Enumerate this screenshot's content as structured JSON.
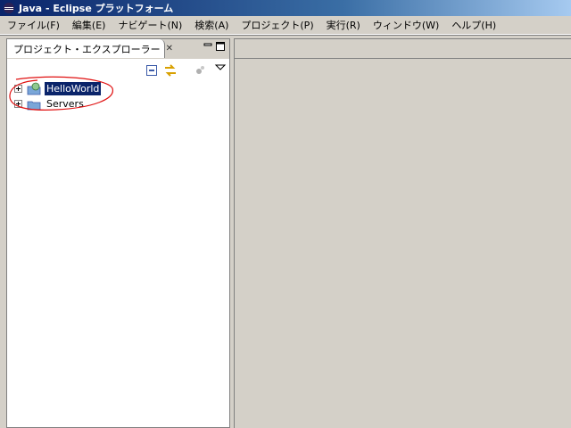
{
  "window": {
    "title": "Java - Eclipse プラットフォーム"
  },
  "menubar": {
    "items": [
      {
        "label": "ファイル(F)"
      },
      {
        "label": "編集(E)"
      },
      {
        "label": "ナビゲート(N)"
      },
      {
        "label": "検索(A)"
      },
      {
        "label": "プロジェクト(P)"
      },
      {
        "label": "実行(R)"
      },
      {
        "label": "ウィンドウ(W)"
      },
      {
        "label": "ヘルプ(H)"
      }
    ]
  },
  "explorer": {
    "tab_label": "プロジェクト・エクスプローラー",
    "close_glyph": "✕",
    "tree": [
      {
        "label": "HelloWorld",
        "selected": true
      },
      {
        "label": "Servers",
        "selected": false
      }
    ]
  },
  "colors": {
    "titlebar_start": "#0a246a",
    "selection": "#0a246a",
    "annotation": "#e01010",
    "background": "#d4d0c8"
  },
  "icons": {
    "app": "eclipse-app-icon",
    "view": "folder-icon",
    "collapse_all": "collapse-all-icon",
    "link_editor": "link-with-editor-icon",
    "filter": "filter-icon",
    "view_menu": "view-menu-icon",
    "project": "project-folder-icon"
  }
}
